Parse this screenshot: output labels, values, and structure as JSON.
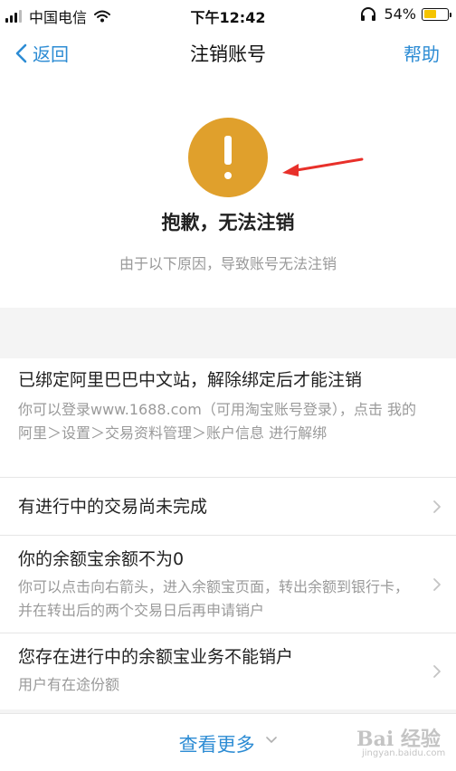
{
  "status_bar": {
    "carrier": "中国电信",
    "time": "下午12:42",
    "battery": "54%",
    "battery_level": 0.54,
    "icons": [
      "signal-icon",
      "wifi-icon",
      "headphone-icon",
      "battery-icon"
    ]
  },
  "nav": {
    "back_label": "返回",
    "title": "注销账号",
    "help_label": "帮助"
  },
  "notice": {
    "icon": "warning-exclamation-icon",
    "icon_color": "#e0a02c",
    "annotation": "red-arrow-icon",
    "title": "抱歉，无法注销",
    "subtitle": "由于以下原因，导致账号无法注销"
  },
  "reasons": [
    {
      "title": "已绑定阿里巴巴中文站，解除绑定后才能注销",
      "desc": "你可以登录www.1688.com（可用淘宝账号登录），点击 我的阿里＞设置＞交易资料管理＞账户信息 进行解绑"
    },
    {
      "title": "有进行中的交易尚未完成",
      "desc": ""
    },
    {
      "title": "你的余额宝余额不为0",
      "desc": "你可以点击向右箭头，进入余额宝页面，转出余额到银行卡，并在转出后的两个交易日后再申请销户"
    },
    {
      "title": "您存在进行中的余额宝业务不能销户",
      "desc": "用户有在途份额"
    }
  ],
  "footer": {
    "more_label": "查看更多",
    "watermark_logo": "Bai 经验",
    "watermark_url": "jingyan.baidu.com"
  },
  "colors": {
    "accent_blue": "#2d8cd4",
    "warning_orange": "#e0a02c",
    "annotation_red": "#e8302a",
    "battery_yellow": "#f5c400"
  }
}
